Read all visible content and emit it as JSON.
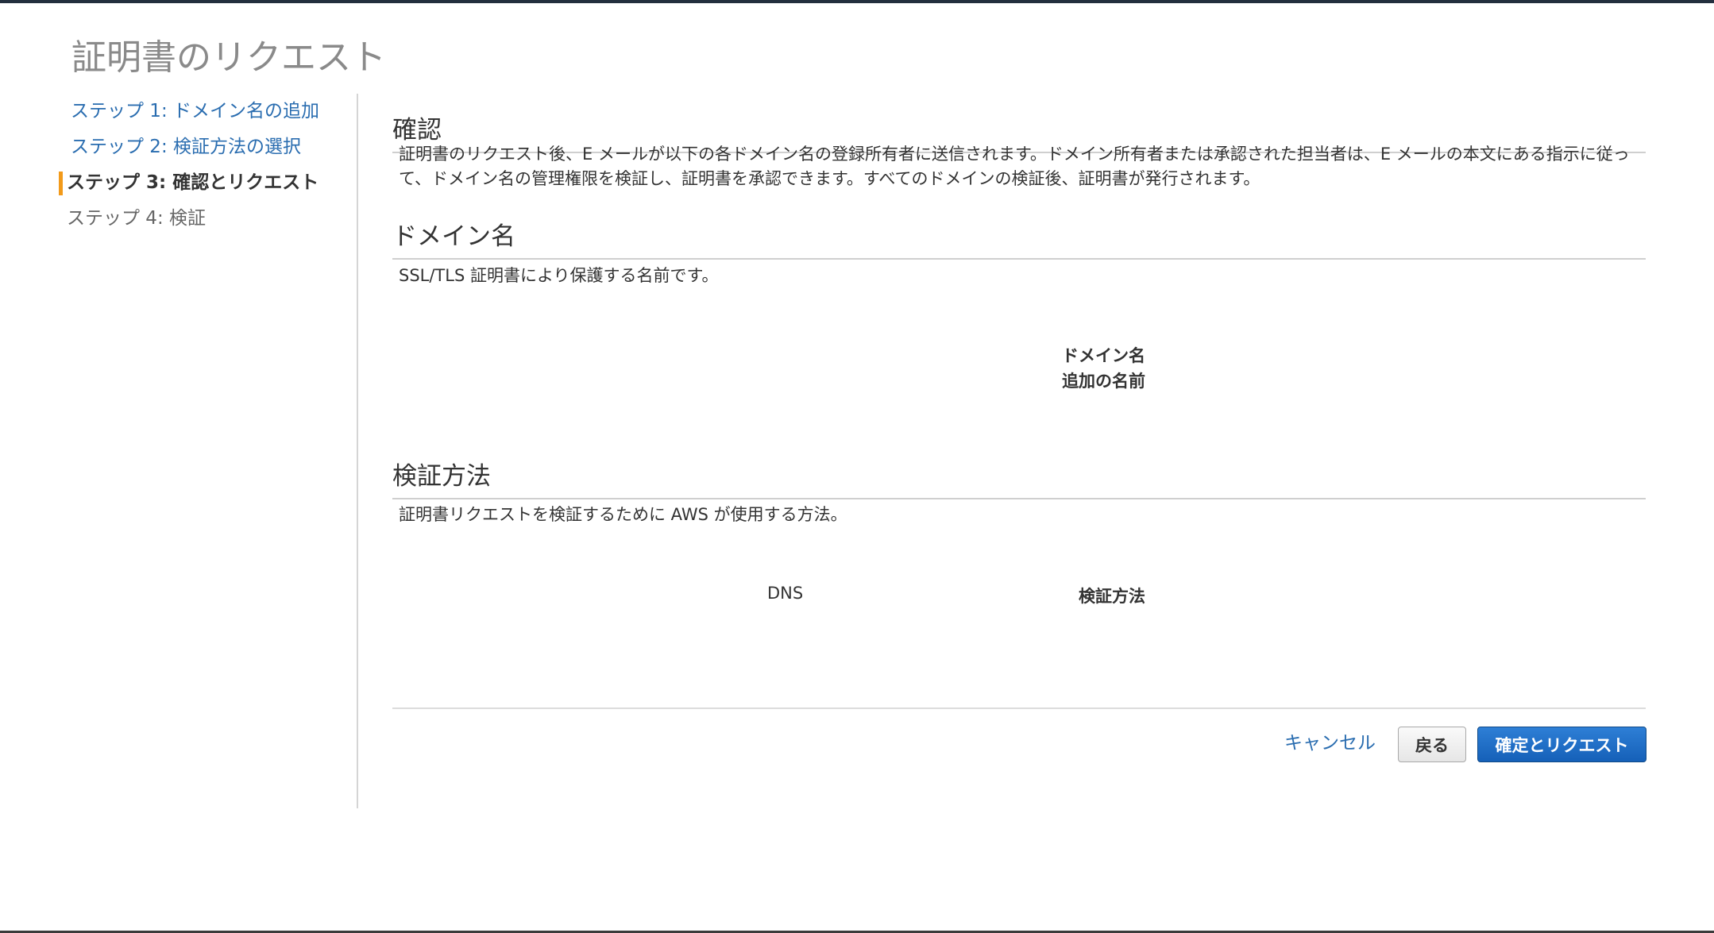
{
  "page": {
    "title": "証明書のリクエスト"
  },
  "steps": [
    {
      "label": "ステップ 1: ドメイン名の追加",
      "state": "link"
    },
    {
      "label": "ステップ 2: 検証方法の選択",
      "state": "link"
    },
    {
      "label": "ステップ 3: 確認とリクエスト",
      "state": "active"
    },
    {
      "label": "ステップ 4: 検証",
      "state": "disabled"
    }
  ],
  "review": {
    "heading": "確認",
    "description": "証明書のリクエスト後、E メールが以下の各ドメイン名の登録所有者に送信されます。ドメイン所有者または承認された担当者は、E メールの本文にある指示に従って、ドメイン名の管理権限を検証し、証明書を承認できます。すべてのドメインの検証後、証明書が発行されます。"
  },
  "domain_section": {
    "heading": "ドメイン名",
    "description": "SSL/TLS 証明書により保護する名前です。",
    "domain_label": "ドメイン名",
    "domain_value": "",
    "additional_label": "追加の名前",
    "additional_value": ""
  },
  "validation_section": {
    "heading": "検証方法",
    "description": "証明書リクエストを検証するために AWS が使用する方法。",
    "method_label": "検証方法",
    "method_value": "DNS"
  },
  "buttons": {
    "cancel": "キャンセル",
    "back": "戻る",
    "confirm": "確定とリクエスト"
  },
  "colors": {
    "active_step_marker": "#f29a1a",
    "link": "#2a6db0",
    "primary_button": "#1a6cc6"
  }
}
